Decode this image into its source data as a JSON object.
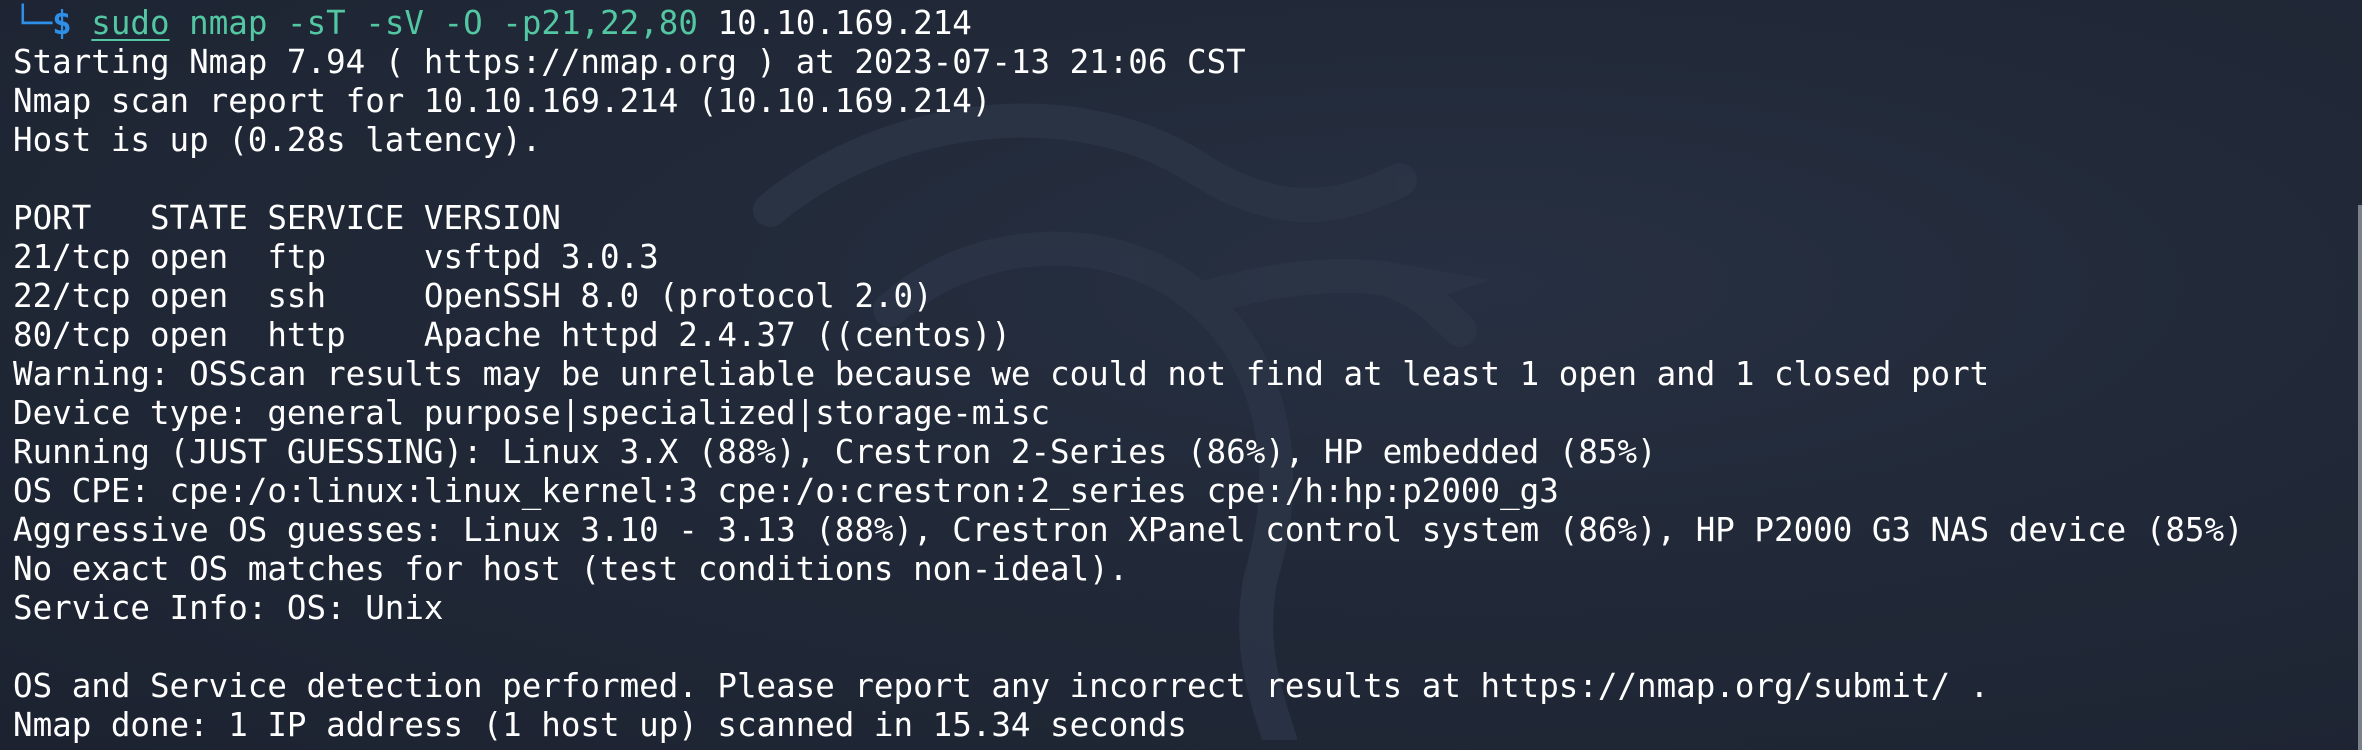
{
  "prompt": {
    "corner": "└─",
    "dollar": "$",
    "sudo": "sudo",
    "command": "nmap",
    "flags": "-sT -sV -O -p21,22,80",
    "target": "10.10.169.214"
  },
  "output": [
    "Starting Nmap 7.94 ( https://nmap.org ) at 2023-07-13 21:06 CST",
    "Nmap scan report for 10.10.169.214 (10.10.169.214)",
    "Host is up (0.28s latency).",
    "",
    "PORT   STATE SERVICE VERSION",
    "21/tcp open  ftp     vsftpd 3.0.3",
    "22/tcp open  ssh     OpenSSH 8.0 (protocol 2.0)",
    "80/tcp open  http    Apache httpd 2.4.37 ((centos))",
    "Warning: OSScan results may be unreliable because we could not find at least 1 open and 1 closed port",
    "Device type: general purpose|specialized|storage-misc",
    "Running (JUST GUESSING): Linux 3.X (88%), Crestron 2-Series (86%), HP embedded (85%)",
    "OS CPE: cpe:/o:linux:linux_kernel:3 cpe:/o:crestron:2_series cpe:/h:hp:p2000_g3",
    "Aggressive OS guesses: Linux 3.10 - 3.13 (88%), Crestron XPanel control system (86%), HP P2000 G3 NAS device (85%)",
    "No exact OS matches for host (test conditions non-ideal).",
    "Service Info: OS: Unix",
    "",
    "OS and Service detection performed. Please report any incorrect results at https://nmap.org/submit/ .",
    "Nmap done: 1 IP address (1 host up) scanned in 15.34 seconds"
  ],
  "colors": {
    "prompt": "#2f8ee6",
    "command": "#53c6a2",
    "text": "#ffffff",
    "background": "#1d2330"
  }
}
